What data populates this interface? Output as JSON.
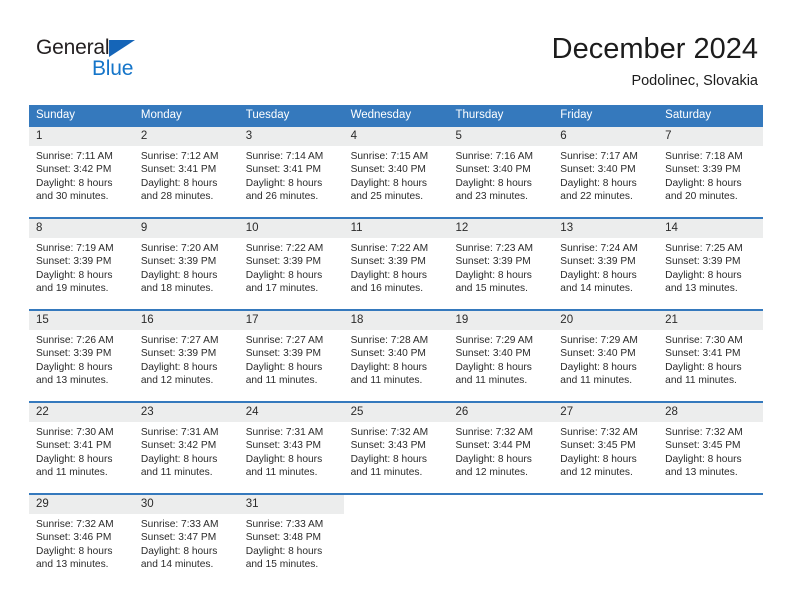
{
  "branding": {
    "name_part1": "General",
    "name_part2": "Blue"
  },
  "header": {
    "title": "December 2024",
    "subtitle": "Podolinec, Slovakia"
  },
  "colors": {
    "header_blue": "#3579bd",
    "logo_blue": "#1575c9",
    "date_band": "#eceded"
  },
  "weekdays": [
    "Sunday",
    "Monday",
    "Tuesday",
    "Wednesday",
    "Thursday",
    "Friday",
    "Saturday"
  ],
  "weeks": [
    [
      {
        "day": "1",
        "sunrise": "Sunrise: 7:11 AM",
        "sunset": "Sunset: 3:42 PM",
        "daylight1": "Daylight: 8 hours",
        "daylight2": "and 30 minutes."
      },
      {
        "day": "2",
        "sunrise": "Sunrise: 7:12 AM",
        "sunset": "Sunset: 3:41 PM",
        "daylight1": "Daylight: 8 hours",
        "daylight2": "and 28 minutes."
      },
      {
        "day": "3",
        "sunrise": "Sunrise: 7:14 AM",
        "sunset": "Sunset: 3:41 PM",
        "daylight1": "Daylight: 8 hours",
        "daylight2": "and 26 minutes."
      },
      {
        "day": "4",
        "sunrise": "Sunrise: 7:15 AM",
        "sunset": "Sunset: 3:40 PM",
        "daylight1": "Daylight: 8 hours",
        "daylight2": "and 25 minutes."
      },
      {
        "day": "5",
        "sunrise": "Sunrise: 7:16 AM",
        "sunset": "Sunset: 3:40 PM",
        "daylight1": "Daylight: 8 hours",
        "daylight2": "and 23 minutes."
      },
      {
        "day": "6",
        "sunrise": "Sunrise: 7:17 AM",
        "sunset": "Sunset: 3:40 PM",
        "daylight1": "Daylight: 8 hours",
        "daylight2": "and 22 minutes."
      },
      {
        "day": "7",
        "sunrise": "Sunrise: 7:18 AM",
        "sunset": "Sunset: 3:39 PM",
        "daylight1": "Daylight: 8 hours",
        "daylight2": "and 20 minutes."
      }
    ],
    [
      {
        "day": "8",
        "sunrise": "Sunrise: 7:19 AM",
        "sunset": "Sunset: 3:39 PM",
        "daylight1": "Daylight: 8 hours",
        "daylight2": "and 19 minutes."
      },
      {
        "day": "9",
        "sunrise": "Sunrise: 7:20 AM",
        "sunset": "Sunset: 3:39 PM",
        "daylight1": "Daylight: 8 hours",
        "daylight2": "and 18 minutes."
      },
      {
        "day": "10",
        "sunrise": "Sunrise: 7:22 AM",
        "sunset": "Sunset: 3:39 PM",
        "daylight1": "Daylight: 8 hours",
        "daylight2": "and 17 minutes."
      },
      {
        "day": "11",
        "sunrise": "Sunrise: 7:22 AM",
        "sunset": "Sunset: 3:39 PM",
        "daylight1": "Daylight: 8 hours",
        "daylight2": "and 16 minutes."
      },
      {
        "day": "12",
        "sunrise": "Sunrise: 7:23 AM",
        "sunset": "Sunset: 3:39 PM",
        "daylight1": "Daylight: 8 hours",
        "daylight2": "and 15 minutes."
      },
      {
        "day": "13",
        "sunrise": "Sunrise: 7:24 AM",
        "sunset": "Sunset: 3:39 PM",
        "daylight1": "Daylight: 8 hours",
        "daylight2": "and 14 minutes."
      },
      {
        "day": "14",
        "sunrise": "Sunrise: 7:25 AM",
        "sunset": "Sunset: 3:39 PM",
        "daylight1": "Daylight: 8 hours",
        "daylight2": "and 13 minutes."
      }
    ],
    [
      {
        "day": "15",
        "sunrise": "Sunrise: 7:26 AM",
        "sunset": "Sunset: 3:39 PM",
        "daylight1": "Daylight: 8 hours",
        "daylight2": "and 13 minutes."
      },
      {
        "day": "16",
        "sunrise": "Sunrise: 7:27 AM",
        "sunset": "Sunset: 3:39 PM",
        "daylight1": "Daylight: 8 hours",
        "daylight2": "and 12 minutes."
      },
      {
        "day": "17",
        "sunrise": "Sunrise: 7:27 AM",
        "sunset": "Sunset: 3:39 PM",
        "daylight1": "Daylight: 8 hours",
        "daylight2": "and 11 minutes."
      },
      {
        "day": "18",
        "sunrise": "Sunrise: 7:28 AM",
        "sunset": "Sunset: 3:40 PM",
        "daylight1": "Daylight: 8 hours",
        "daylight2": "and 11 minutes."
      },
      {
        "day": "19",
        "sunrise": "Sunrise: 7:29 AM",
        "sunset": "Sunset: 3:40 PM",
        "daylight1": "Daylight: 8 hours",
        "daylight2": "and 11 minutes."
      },
      {
        "day": "20",
        "sunrise": "Sunrise: 7:29 AM",
        "sunset": "Sunset: 3:40 PM",
        "daylight1": "Daylight: 8 hours",
        "daylight2": "and 11 minutes."
      },
      {
        "day": "21",
        "sunrise": "Sunrise: 7:30 AM",
        "sunset": "Sunset: 3:41 PM",
        "daylight1": "Daylight: 8 hours",
        "daylight2": "and 11 minutes."
      }
    ],
    [
      {
        "day": "22",
        "sunrise": "Sunrise: 7:30 AM",
        "sunset": "Sunset: 3:41 PM",
        "daylight1": "Daylight: 8 hours",
        "daylight2": "and 11 minutes."
      },
      {
        "day": "23",
        "sunrise": "Sunrise: 7:31 AM",
        "sunset": "Sunset: 3:42 PM",
        "daylight1": "Daylight: 8 hours",
        "daylight2": "and 11 minutes."
      },
      {
        "day": "24",
        "sunrise": "Sunrise: 7:31 AM",
        "sunset": "Sunset: 3:43 PM",
        "daylight1": "Daylight: 8 hours",
        "daylight2": "and 11 minutes."
      },
      {
        "day": "25",
        "sunrise": "Sunrise: 7:32 AM",
        "sunset": "Sunset: 3:43 PM",
        "daylight1": "Daylight: 8 hours",
        "daylight2": "and 11 minutes."
      },
      {
        "day": "26",
        "sunrise": "Sunrise: 7:32 AM",
        "sunset": "Sunset: 3:44 PM",
        "daylight1": "Daylight: 8 hours",
        "daylight2": "and 12 minutes."
      },
      {
        "day": "27",
        "sunrise": "Sunrise: 7:32 AM",
        "sunset": "Sunset: 3:45 PM",
        "daylight1": "Daylight: 8 hours",
        "daylight2": "and 12 minutes."
      },
      {
        "day": "28",
        "sunrise": "Sunrise: 7:32 AM",
        "sunset": "Sunset: 3:45 PM",
        "daylight1": "Daylight: 8 hours",
        "daylight2": "and 13 minutes."
      }
    ],
    [
      {
        "day": "29",
        "sunrise": "Sunrise: 7:32 AM",
        "sunset": "Sunset: 3:46 PM",
        "daylight1": "Daylight: 8 hours",
        "daylight2": "and 13 minutes."
      },
      {
        "day": "30",
        "sunrise": "Sunrise: 7:33 AM",
        "sunset": "Sunset: 3:47 PM",
        "daylight1": "Daylight: 8 hours",
        "daylight2": "and 14 minutes."
      },
      {
        "day": "31",
        "sunrise": "Sunrise: 7:33 AM",
        "sunset": "Sunset: 3:48 PM",
        "daylight1": "Daylight: 8 hours",
        "daylight2": "and 15 minutes."
      },
      {
        "day": "",
        "sunrise": "",
        "sunset": "",
        "daylight1": "",
        "daylight2": ""
      },
      {
        "day": "",
        "sunrise": "",
        "sunset": "",
        "daylight1": "",
        "daylight2": ""
      },
      {
        "day": "",
        "sunrise": "",
        "sunset": "",
        "daylight1": "",
        "daylight2": ""
      },
      {
        "day": "",
        "sunrise": "",
        "sunset": "",
        "daylight1": "",
        "daylight2": ""
      }
    ]
  ]
}
